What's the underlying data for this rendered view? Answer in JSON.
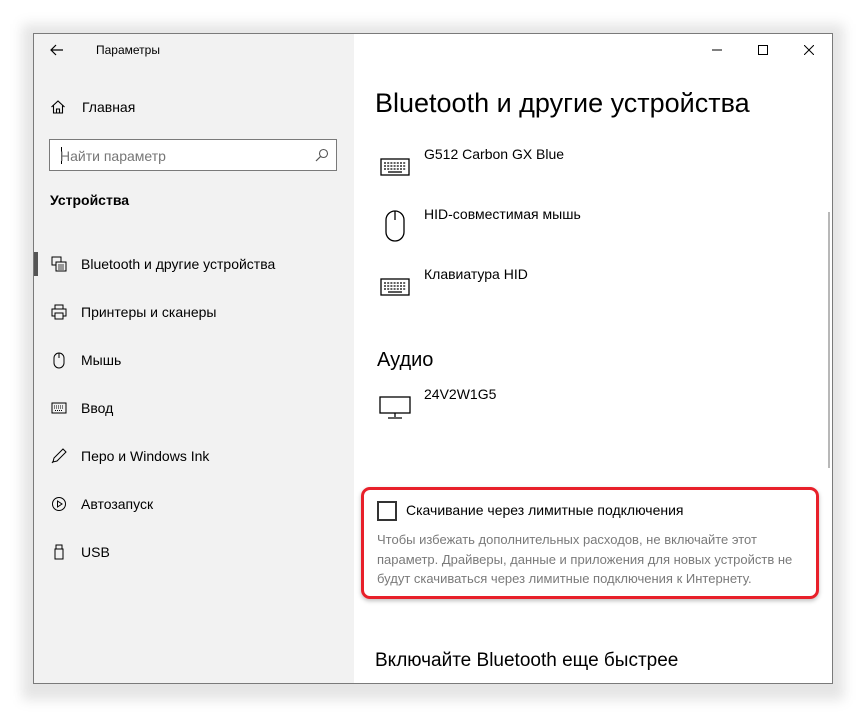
{
  "window": {
    "title": "Параметры"
  },
  "sidebar": {
    "home_label": "Главная",
    "search": {
      "placeholder": "Найти параметр",
      "value": ""
    },
    "section_header": "Устройства",
    "items": [
      {
        "label": "Bluetooth и другие устройства",
        "icon": "bluetooth-devices-icon",
        "active": true
      },
      {
        "label": "Принтеры и сканеры",
        "icon": "printer-icon"
      },
      {
        "label": "Мышь",
        "icon": "mouse-icon"
      },
      {
        "label": "Ввод",
        "icon": "keyboard-icon"
      },
      {
        "label": "Перо и Windows Ink",
        "icon": "pen-icon"
      },
      {
        "label": "Автозапуск",
        "icon": "autoplay-icon"
      },
      {
        "label": "USB",
        "icon": "usb-icon"
      }
    ]
  },
  "main": {
    "title": "Bluetooth и другие устройства",
    "devices": [
      {
        "name": "G512 Carbon GX Blue",
        "icon": "keyboard-icon"
      },
      {
        "name": "HID-совместимая мышь",
        "icon": "mouse-icon"
      },
      {
        "name": "Клавиатура HID",
        "icon": "keyboard-icon"
      }
    ],
    "audio_header": "Аудио",
    "audio_devices": [
      {
        "name": "24V2W1G5",
        "icon": "monitor-icon"
      }
    ],
    "metered": {
      "label": "Скачивание через лимитные подключения",
      "checked": false,
      "description": "Чтобы избежать дополнительных расходов, не включайте этот параметр. Драйверы, данные и приложения для новых устройств не будут скачиваться через лимитные подключения к Интернету."
    },
    "bt_faster_header": "Включайте Bluetooth еще быстрее"
  },
  "colors": {
    "highlight": "#e8202a",
    "sidebar_bg": "#f2f2f2",
    "muted_text": "#7a7a7a"
  }
}
